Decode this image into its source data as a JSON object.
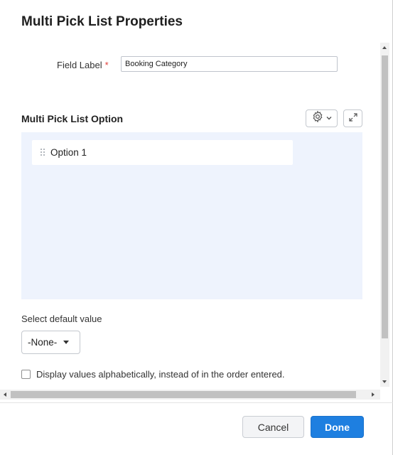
{
  "dialog": {
    "title": "Multi Pick List Properties"
  },
  "field": {
    "label": "Field Label",
    "required_mark": "*",
    "value": "Booking Category"
  },
  "options_section": {
    "title": "Multi Pick List Option",
    "settings_icon": "gear-icon",
    "expand_icon": "expand-icon",
    "options": [
      {
        "label": "Option 1"
      }
    ]
  },
  "default_value": {
    "label": "Select default value",
    "selected": "-None-"
  },
  "sort_option": {
    "label": "Display values alphabetically, instead of in the order entered.",
    "checked": false
  },
  "footer": {
    "cancel_label": "Cancel",
    "done_label": "Done"
  },
  "colors": {
    "accent": "#1e7fe0",
    "panel_bg": "#eef3fd",
    "required": "#e0413a"
  }
}
